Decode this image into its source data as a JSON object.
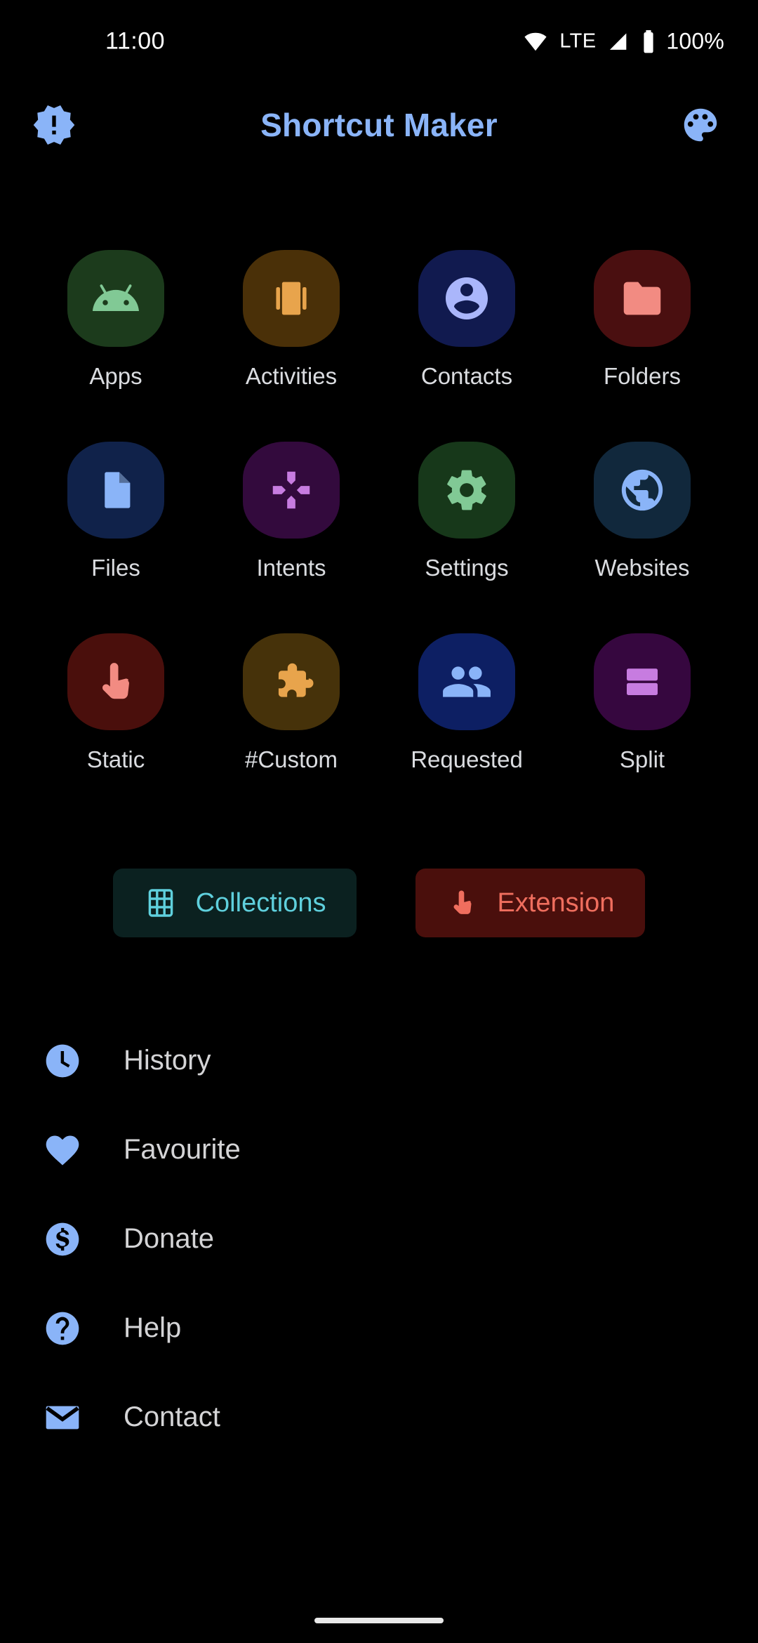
{
  "status_bar": {
    "time": "11:00",
    "network_type": "LTE",
    "battery_percent": "100%",
    "icons": [
      "wifi-icon",
      "signal-icon",
      "battery-icon"
    ]
  },
  "app_bar": {
    "title": "Shortcut Maker",
    "left_icon": "new-releases-icon",
    "right_icon": "palette-icon",
    "title_color": "#8AB4F8"
  },
  "grid": {
    "tiles": [
      {
        "label": "Apps",
        "icon": "android-icon",
        "bg": "#1c3b1c",
        "fg": "#81c995"
      },
      {
        "label": "Activities",
        "icon": "book-icon",
        "bg": "#4a3008",
        "fg": "#e8a martin"
      },
      {
        "label": "Contacts",
        "icon": "person-icon",
        "bg": "#111a4f",
        "fg": "#aab6fb"
      },
      {
        "label": "Folders",
        "icon": "folder-icon",
        "bg": "#4a0f10",
        "fg": "#f28b82"
      },
      {
        "label": "Files",
        "icon": "document-icon",
        "bg": "#10224a",
        "fg": "#8ab4f8"
      },
      {
        "label": "Intents",
        "icon": "open-with-icon",
        "bg": "#330a3d",
        "fg": "#c77ce0"
      },
      {
        "label": "Settings",
        "icon": "gear-icon",
        "bg": "#17381a",
        "fg": "#81c995"
      },
      {
        "label": "Websites",
        "icon": "globe-icon",
        "bg": "#11283c",
        "fg": "#8ab4f8"
      },
      {
        "label": "Static",
        "icon": "touch-icon",
        "bg": "#4a0f0c",
        "fg": "#f28b82"
      },
      {
        "label": "#Custom",
        "icon": "puzzle-icon",
        "bg": "#46320a",
        "fg": "#e8a44c"
      },
      {
        "label": "Requested",
        "icon": "people-icon",
        "bg": "#0d1f63",
        "fg": "#8ab4f8"
      },
      {
        "label": "Split",
        "icon": "split-screen-icon",
        "bg": "#36073f",
        "fg": "#c77ce0"
      }
    ]
  },
  "actions": {
    "collections": {
      "label": "Collections",
      "icon": "grid-view-icon",
      "bg": "#0B2120",
      "fg": "#5FD0DD"
    },
    "extension": {
      "label": "Extension",
      "icon": "touch-icon",
      "bg": "#4A0F0C",
      "fg": "#EF6E5E"
    }
  },
  "menu": {
    "items": [
      {
        "label": "History",
        "icon": "clock-icon"
      },
      {
        "label": "Favourite",
        "icon": "heart-icon"
      },
      {
        "label": "Donate",
        "icon": "dollar-circle-icon"
      },
      {
        "label": "Help",
        "icon": "question-circle-icon"
      },
      {
        "label": "Contact",
        "icon": "envelope-icon"
      }
    ],
    "icon_color": "#8AB4F8",
    "label_color": "#D4D4D6"
  },
  "nav": {
    "home_indicator": true
  }
}
